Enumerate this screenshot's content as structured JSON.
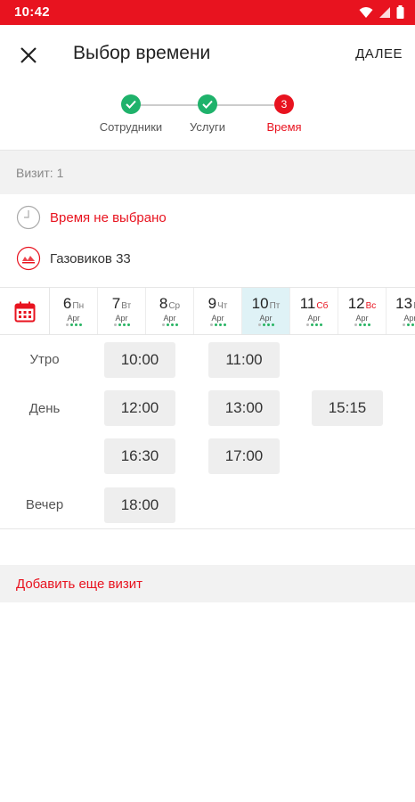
{
  "status_bar": {
    "time": "10:42"
  },
  "header": {
    "title": "Выбор времени",
    "next_label": "ДАЛЕЕ"
  },
  "stepper": {
    "steps": [
      {
        "label": "Сотрудники",
        "state": "done"
      },
      {
        "label": "Услуги",
        "state": "done"
      },
      {
        "label": "Время",
        "state": "active",
        "number": "3"
      }
    ]
  },
  "visit": {
    "title": "Визит: 1",
    "time_status": "Время не выбрано",
    "location": "Газовиков 33"
  },
  "dates": [
    {
      "day": "6",
      "weekday": "Пн",
      "month": "Apr",
      "weekend": false,
      "selected": false
    },
    {
      "day": "7",
      "weekday": "Вт",
      "month": "Apr",
      "weekend": false,
      "selected": false
    },
    {
      "day": "8",
      "weekday": "Ср",
      "month": "Apr",
      "weekend": false,
      "selected": false
    },
    {
      "day": "9",
      "weekday": "Чт",
      "month": "Apr",
      "weekend": false,
      "selected": false
    },
    {
      "day": "10",
      "weekday": "Пт",
      "month": "Apr",
      "weekend": false,
      "selected": true
    },
    {
      "day": "11",
      "weekday": "Сб",
      "month": "Apr",
      "weekend": true,
      "selected": false
    },
    {
      "day": "12",
      "weekday": "Вс",
      "month": "Apr",
      "weekend": true,
      "selected": false
    },
    {
      "day": "13",
      "weekday": "Пн",
      "month": "Apr",
      "weekend": false,
      "selected": false
    }
  ],
  "schedule": {
    "morning": {
      "label": "Утро",
      "slots": [
        "10:00",
        "11:00"
      ]
    },
    "day": {
      "label": "День",
      "slots": [
        "12:00",
        "13:00",
        "15:15",
        "16:30",
        "17:00"
      ]
    },
    "evening": {
      "label": "Вечер",
      "slots": [
        "18:00"
      ]
    }
  },
  "add_visit_label": "Добавить еще визит",
  "colors": {
    "accent": "#e8131f",
    "success": "#1fb26b",
    "selected_day": "#dff2f6"
  }
}
